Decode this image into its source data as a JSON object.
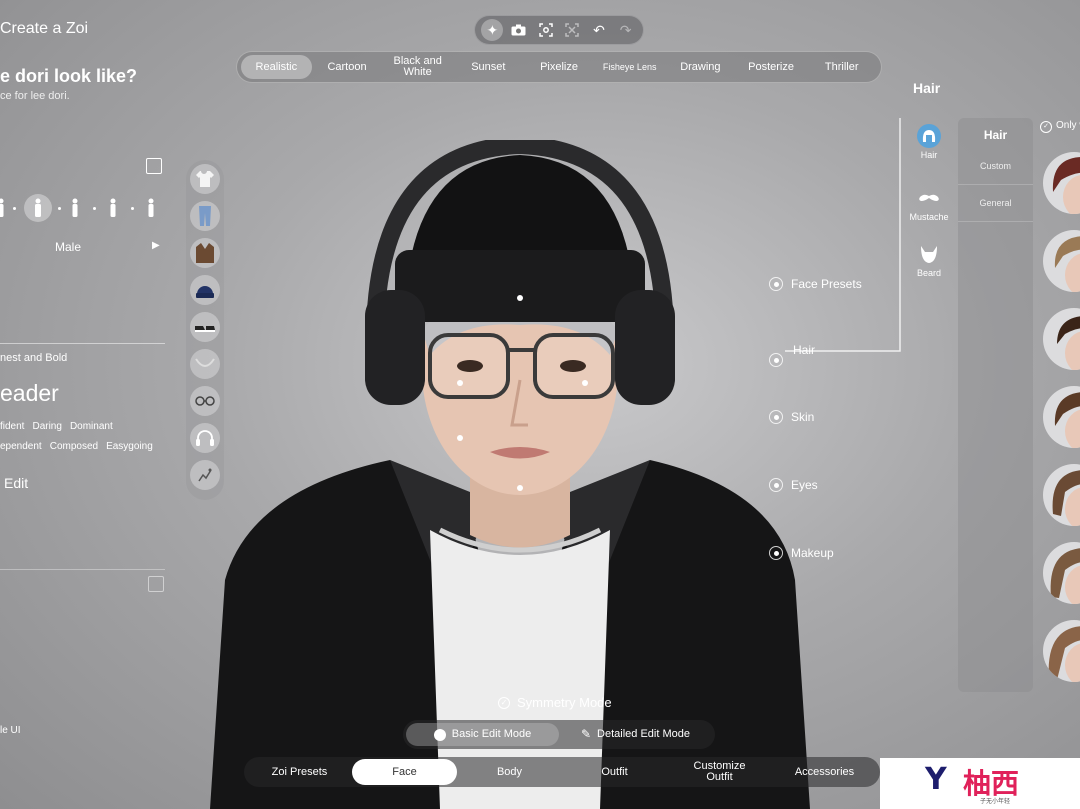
{
  "app_title": "Create a Zoi",
  "toolbar": {
    "tools": [
      "sparkle-icon",
      "camera-icon",
      "focus-icon",
      "frame-icon",
      "undo-icon",
      "redo-icon"
    ]
  },
  "filters": [
    "Realistic",
    "Cartoon",
    "Black and White",
    "Sunset",
    "Pixelize",
    "Fisheye Lens",
    "Drawing",
    "Posterize",
    "Thriller"
  ],
  "selected_filter": "Realistic",
  "left_panel": {
    "question": "e dori look like?",
    "question_sub": "ce for lee dori.",
    "gender": "Male",
    "trait_caption": "nest and Bold",
    "trait_title": "eader",
    "traits_row1": [
      "fident",
      "Daring",
      "Dominant"
    ],
    "traits_row2": [
      "ependent",
      "Composed",
      "Easygoing"
    ],
    "edit_label": "Edit",
    "hide_ui": "le UI"
  },
  "face_parts": [
    "Face Presets",
    "Hair",
    "Skin",
    "Eyes",
    "Makeup"
  ],
  "right_panel": {
    "heading": "Hair",
    "categories": [
      {
        "label": "Hair",
        "icon": "hair-icon"
      },
      {
        "label": "Mustache",
        "icon": "mustache-icon"
      },
      {
        "label": "Beard",
        "icon": "beard-icon"
      }
    ],
    "sub_title": "Hair",
    "sub_items": [
      "Custom",
      "General"
    ],
    "only_label": "Only w"
  },
  "symmetry_label": "Symmetry Mode",
  "modes": {
    "basic": "Basic Edit Mode",
    "detailed": "Detailed Edit Mode"
  },
  "bottom_tabs": [
    "Zoi Presets",
    "Face",
    "Body",
    "Outfit",
    "Customize Outfit",
    "Accessories"
  ],
  "selected_tab": "Face",
  "watermark": {
    "logo": "Y",
    "text": "柚西",
    "sub": "子无小年轻"
  },
  "colors": {
    "accent_hair": "#5aa3d8",
    "selected_tab_bg": "#ffffff"
  }
}
